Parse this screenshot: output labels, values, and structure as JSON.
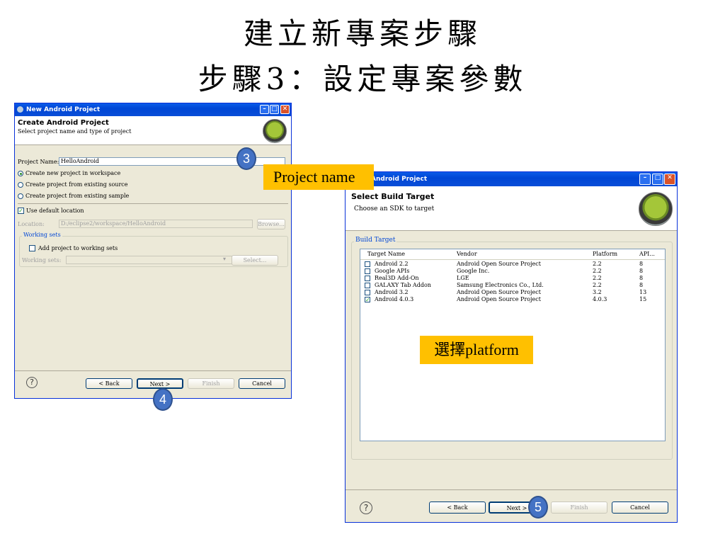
{
  "slide": {
    "title_line1": "建立新專案步驟",
    "title_line2": "步驟3：設定專案參數"
  },
  "win1": {
    "title": "New Android Project",
    "header_title": "Create Android Project",
    "header_desc": "Select project name and type of project",
    "project_name_label": "Project Name:",
    "project_name_value": "HelloAndroid",
    "radio1": "Create new project in workspace",
    "radio2": "Create project from existing source",
    "radio3": "Create project from existing sample",
    "use_default_location": "Use default location",
    "location_label": "Location:",
    "location_value": "D:/eclipse2/workspace/HelloAndroid",
    "browse": "Browse...",
    "working_sets_group": "Working sets",
    "add_working_sets": "Add project to working sets",
    "working_sets_label": "Working sets:",
    "select_button": "Select...",
    "back": "< Back",
    "next": "Next >",
    "finish": "Finish",
    "cancel": "Cancel",
    "help": "?"
  },
  "win2": {
    "title": "Android Project",
    "header_title": "Select Build Target",
    "header_desc": "Choose an SDK to target",
    "group_label": "Build Target",
    "columns": [
      "Target Name",
      "Vendor",
      "Platform",
      "API..."
    ],
    "rows": [
      {
        "name": "Android 2.2",
        "vendor": "Android Open Source Project",
        "platform": "2.2",
        "api": "8",
        "checked": false
      },
      {
        "name": "Google APIs",
        "vendor": "Google Inc.",
        "platform": "2.2",
        "api": "8",
        "checked": false
      },
      {
        "name": "Real3D Add-On",
        "vendor": "LGE",
        "platform": "2.2",
        "api": "8",
        "checked": false
      },
      {
        "name": "GALAXY Tab Addon",
        "vendor": "Samsung Electronics Co., Ltd.",
        "platform": "2.2",
        "api": "8",
        "checked": false
      },
      {
        "name": "Android 3.2",
        "vendor": "Android Open Source Project",
        "platform": "3.2",
        "api": "13",
        "checked": false
      },
      {
        "name": "Android 4.0.3",
        "vendor": "Android Open Source Project",
        "platform": "4.0.3",
        "api": "15",
        "checked": true
      }
    ],
    "back": "< Back",
    "next": "Next >",
    "finish": "Finish",
    "cancel": "Cancel",
    "help": "?"
  },
  "annotations": {
    "badge3": "3",
    "badge4": "4",
    "badge5": "5",
    "callout_project_name": "Project name",
    "callout_platform": "選擇platform"
  }
}
